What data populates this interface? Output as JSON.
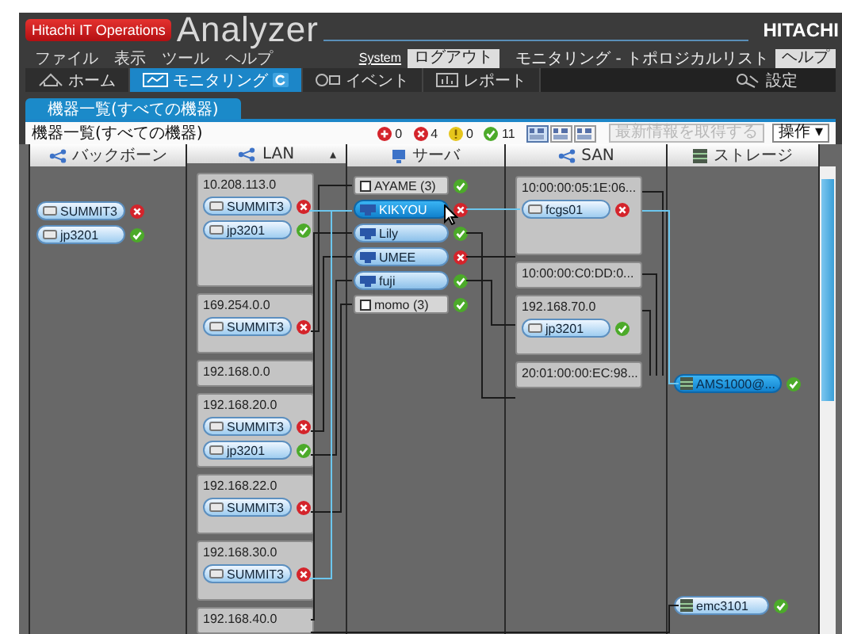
{
  "header": {
    "product_badge": "Hitachi IT Operations",
    "title": "Analyzer",
    "brand": "HITACHI"
  },
  "menu": [
    "ファイル",
    "表示",
    "ツール",
    "ヘルプ"
  ],
  "top_links": [
    {
      "label": "System",
      "kind": "link"
    },
    {
      "label": "ログアウト",
      "kind": "button"
    },
    {
      "label": "モニタリング - トポロジカルリスト",
      "kind": "text"
    },
    {
      "label": "ヘルプ",
      "kind": "button"
    }
  ],
  "nav_tabs": [
    {
      "label": "ホーム",
      "kind": "home",
      "selected": false
    },
    {
      "label": "モニタリング",
      "kind": "monitor",
      "selected": true
    },
    {
      "label": "イベント",
      "kind": "event",
      "selected": false
    },
    {
      "label": "レポート",
      "kind": "report",
      "selected": false
    }
  ],
  "settings": {
    "label": "設定"
  },
  "sub_tabs": [
    {
      "label": "機器一覧(すべての機器)",
      "selected": true
    }
  ],
  "toolbar": {
    "title": "機器一覧(すべての機器)",
    "counts": [
      {
        "kind": "critical",
        "count": "0"
      },
      {
        "kind": "error",
        "count": "4"
      },
      {
        "kind": "warning",
        "count": "0"
      },
      {
        "kind": "ok",
        "count": "11"
      }
    ],
    "view_buttons": [
      {
        "selected": true
      },
      {
        "selected": false
      },
      {
        "selected": false
      }
    ],
    "refresh_button": {
      "label": "最新情報を取得する",
      "disabled": true
    },
    "action_button": {
      "label": "操作",
      "caret": "▾"
    }
  },
  "columns": [
    {
      "kind": "backbone",
      "header": "バックボーン",
      "items": [
        {
          "kind": "device",
          "name": "SUMMIT3",
          "error": true,
          "selected": false
        },
        {
          "kind": "device",
          "name": "jp3201",
          "error": false,
          "selected": false
        }
      ]
    },
    {
      "kind": "lan",
      "header": "LAN",
      "sort_mark": "▴",
      "items": [
        {
          "kind": "group",
          "title": "10.208.113.0",
          "nodes": [
            {
              "name": "SUMMIT3",
              "error": true,
              "selected": false
            },
            {
              "name": "jp3201",
              "error": false,
              "selected": false
            }
          ]
        },
        {
          "kind": "group",
          "title": "169.254.0.0",
          "nodes": [
            {
              "name": "SUMMIT3",
              "error": true,
              "selected": false
            }
          ]
        },
        {
          "kind": "group",
          "title": "192.168.0.0"
        },
        {
          "kind": "group",
          "title": "192.168.20.0",
          "nodes": [
            {
              "name": "SUMMIT3",
              "error": true,
              "selected": false
            },
            {
              "name": "jp3201",
              "error": false,
              "selected": false
            }
          ]
        },
        {
          "kind": "group",
          "title": "192.168.22.0",
          "nodes": [
            {
              "name": "SUMMIT3",
              "error": true,
              "selected": false
            }
          ]
        },
        {
          "kind": "group",
          "title": "192.168.30.0",
          "nodes": [
            {
              "name": "SUMMIT3",
              "error": true,
              "selected": false
            }
          ]
        },
        {
          "kind": "group",
          "title": "192.168.40.0"
        }
      ]
    },
    {
      "kind": "server",
      "header": "サーバ",
      "items": [
        {
          "kind": "host",
          "name": "AYAME (3)",
          "error": false,
          "selected": false
        },
        {
          "kind": "vm",
          "name": "KIKYOU",
          "error": true,
          "selected": true
        },
        {
          "kind": "vm",
          "name": "Lily",
          "error": false,
          "selected": false
        },
        {
          "kind": "vm",
          "name": "UMEE",
          "error": true,
          "selected": false
        },
        {
          "kind": "vm",
          "name": "fuji",
          "error": false,
          "selected": false
        },
        {
          "kind": "host",
          "name": "momo (3)",
          "error": false,
          "selected": false
        }
      ]
    },
    {
      "kind": "san",
      "header": "SAN",
      "items": [
        {
          "kind": "group",
          "title": "10:00:00:05:1E:06...",
          "nodes": [
            {
              "name": "fcgs01",
              "error": true,
              "selected": false
            }
          ]
        },
        {
          "kind": "group",
          "title": "10:00:00:C0:DD:0..."
        },
        {
          "kind": "group",
          "title": "192.168.70.0",
          "nodes": [
            {
              "name": "jp3201",
              "error": false,
              "selected": false
            }
          ]
        },
        {
          "kind": "group",
          "title": "20:01:00:00:EC:98..."
        }
      ]
    },
    {
      "kind": "storage",
      "header": "ストレージ",
      "items": [
        {
          "kind": "storage",
          "name": "AMS1000@...",
          "error": false,
          "selected": true
        },
        {
          "kind": "storage",
          "name": "emc3101",
          "error": false,
          "selected": false
        }
      ]
    }
  ]
}
